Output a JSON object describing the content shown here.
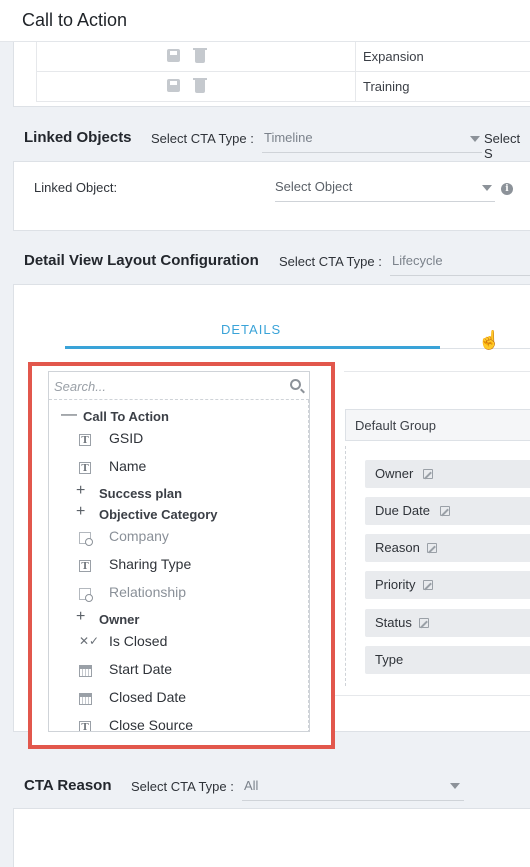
{
  "header": {
    "title": "Call to Action"
  },
  "top_table": {
    "rows": [
      "Expansion",
      "Training"
    ]
  },
  "linked_objects": {
    "title": "Linked Objects",
    "cta_type_label": "Select CTA Type :",
    "cta_type_value": "Timeline",
    "select_s_label": "Select S",
    "linked_object_label": "Linked Object:",
    "select_object_placeholder": "Select Object"
  },
  "detail_view": {
    "title": "Detail View Layout Configuration",
    "cta_type_label": "Select CTA Type :",
    "cta_type_value": "Lifecycle",
    "tab_details": "DETAILS"
  },
  "picker": {
    "search_placeholder": "Search...",
    "group_call_to_action": "Call To Action",
    "items": {
      "gsid": "GSID",
      "name": "Name",
      "success_plan": "Success plan",
      "objective_category": "Objective Category",
      "company": "Company",
      "sharing_type": "Sharing Type",
      "relationship": "Relationship",
      "owner": "Owner",
      "is_closed": "Is Closed",
      "start_date": "Start Date",
      "closed_date": "Closed Date",
      "close_source": "Close Source"
    }
  },
  "default_group": {
    "title": "Default Group",
    "fields": [
      "Owner",
      "Due Date",
      "Reason",
      "Priority",
      "Status",
      "Type"
    ]
  },
  "cta_reason": {
    "title": "CTA Reason",
    "cta_type_label": "Select CTA Type :",
    "cta_type_value": "All"
  },
  "colors": {
    "accent": "#3aa3d8",
    "highlight_border": "#e2574c"
  },
  "icons": [
    "save-icon",
    "trash-icon",
    "info-icon",
    "search-icon",
    "text-field-icon",
    "lookup-icon",
    "boolean-icon",
    "date-icon",
    "edit-icon",
    "hand-cursor-icon"
  ]
}
